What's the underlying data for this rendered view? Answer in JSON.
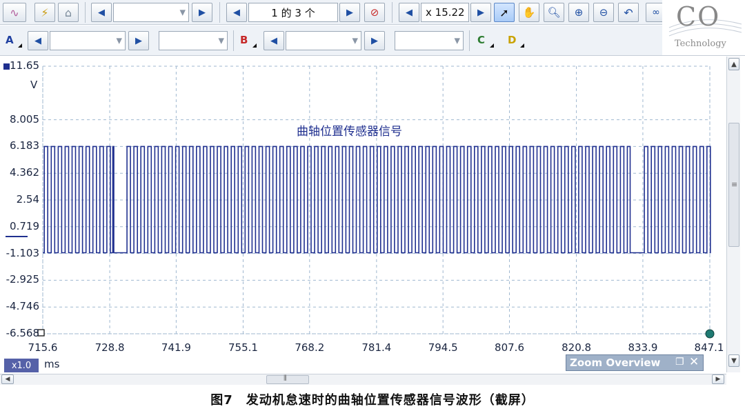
{
  "toolbar": {
    "pager_text": "1 的 3 个",
    "zoom_text": "x 15.22"
  },
  "channels": {
    "a_label": "A",
    "b_label": "B",
    "c_label": "C",
    "d_label": "D",
    "colors": {
      "a": "#1f3fa0",
      "b": "#c62828",
      "c": "#2e7d32",
      "d": "#c9a200"
    }
  },
  "logo": {
    "text": "CO",
    "sub": "Technology"
  },
  "scope": {
    "unit": "V",
    "y_ticks": [
      "11.65",
      "8.005",
      "6.183",
      "4.362",
      "2.54",
      "0.719",
      "-1.103",
      "-2.925",
      "-4.746",
      "-6.568"
    ],
    "x_ticks": [
      "715.6",
      "728.8",
      "741.9",
      "755.1",
      "768.2",
      "781.4",
      "794.5",
      "807.6",
      "820.8",
      "833.9",
      "847.1"
    ],
    "time_unit": "ms",
    "scale_badge": "x1.0",
    "annotation": "曲轴位置传感器信号",
    "trace_color": "#1f2f8f",
    "grid_color": "#9fb7cf"
  },
  "zoom_overview": {
    "title": "Zoom Overview"
  },
  "caption": "图7　发动机怠速时的曲轴位置传感器信号波形（截屏）",
  "chart_data": {
    "type": "line",
    "title": "曲轴位置传感器信号",
    "xlabel": "ms",
    "ylabel": "V",
    "xlim": [
      715.6,
      847.1
    ],
    "ylim": [
      -6.568,
      11.65
    ],
    "grid": true,
    "series": [
      {
        "description_levels": {
          "high": 6.183,
          "low": -1.05
        },
        "pulse_period_ms": 1.37,
        "gaps_ms": [
          [
            728.8,
            732.2
          ],
          [
            830.8,
            834.2
          ]
        ],
        "duty_high_fraction": 0.5
      }
    ]
  }
}
